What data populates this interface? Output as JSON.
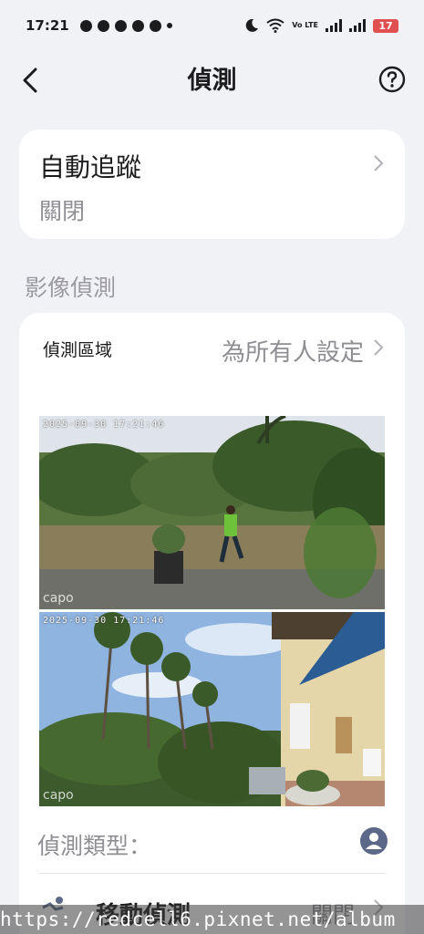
{
  "status_bar": {
    "time": "17:21",
    "battery": "17",
    "network_label": "Vo LTE"
  },
  "header": {
    "title": "偵測",
    "back_icon": "chevron-left-icon",
    "help_icon": "question-circle-icon"
  },
  "auto_tracking": {
    "title": "自動追蹤",
    "value": "關閉"
  },
  "section": {
    "label": "影像偵測"
  },
  "detection_zone": {
    "label": "偵測區域",
    "value": "為所有人設定"
  },
  "previews": [
    {
      "timestamp": "2025-09-30 17:21:46",
      "watermark": "capo"
    },
    {
      "timestamp": "2025-09-30 17:21:46",
      "watermark": "capo"
    }
  ],
  "detection_type": {
    "label": "偵測類型：",
    "icon": "person-circle-icon",
    "accent_color": "#5b6887"
  },
  "motion_detection": {
    "label": "移動偵測",
    "value": "關閉"
  },
  "footer_url": "https://redcell6.pixnet.net/album"
}
